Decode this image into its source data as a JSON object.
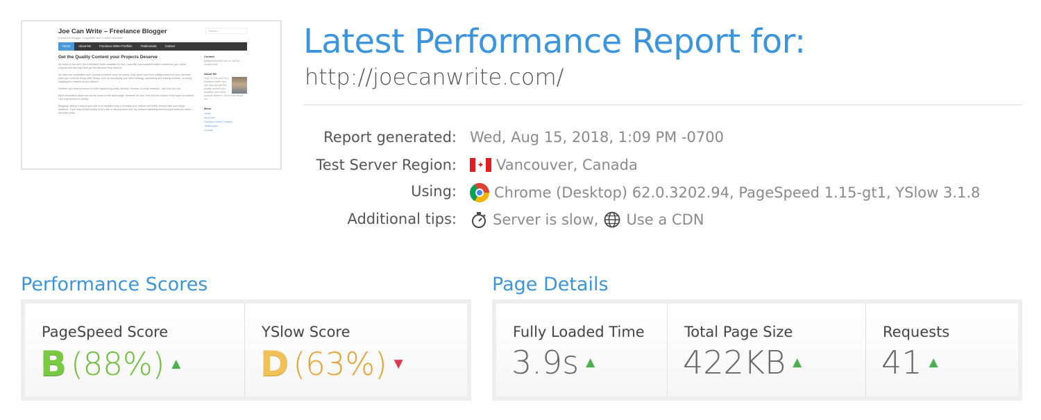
{
  "thumbnail": {
    "site_title": "Joe Can Write – Freelance Blogger",
    "tagline": "Freelance Blogger, Copywriter and Content Marketer",
    "search_placeholder": "Search ...",
    "nav": [
      "Home",
      "About Me",
      "Freelance Writer Portfolio",
      "Testimonials",
      "Contact"
    ],
    "heading": "Get the Quality Content your Projects Deserve",
    "paragraphs": [
      "My name is Joe and I am a freelance writer available for hire. I can offer you excellent written content for your online projects that can help them get the attention they deserve.",
      "My rates are competitive and I provide excellent value for money. Why spend your time writing content for your websites when you could be doing other things, such as developing your site's strategy, networking and making contacts, or simply enjoying the rewards of your labour?",
      "Whether you need someone to write regular blog posts, tutorials, reviews, or press releases, I can help you out.",
      "More information about me can be found on the about page. However for now, here is a list of some of the types of content I am experienced in writing:",
      "Blogging: adding a blog to your site is an excellent way to increase your visitors and better connect with your target audience. If you want to add a blog to your site or already have one, my content marketing service is just what you need. I can write posts"
    ],
    "sidebar": {
      "contact_heading": "Contact",
      "contact_text": "joe@joecanwrite.com or use the contact form",
      "about_heading": "About Me",
      "about_text": "Hey! I'm Joe and I'm a freelance writer who can help you get the quality content your websites and online projects deserve. Read more about me",
      "menu_heading": "Menu",
      "menu_items": [
        "Home",
        "About Me",
        "Freelance Writer Portfolio",
        "Testimonials",
        "Contact"
      ]
    }
  },
  "report": {
    "title": "Latest Performance Report for:",
    "url": "http://joecanwrite.com/",
    "generated_label": "Report generated:",
    "generated_value": "Wed, Aug 15, 2018, 1:09 PM -0700",
    "region_label": "Test Server Region:",
    "region_value": "Vancouver, Canada",
    "using_label": "Using:",
    "using_value": "Chrome (Desktop) 62.0.3202.94, PageSpeed 1.15-gt1, YSlow 3.1.8",
    "tips_label": "Additional tips:",
    "tip_1": "Server is slow,",
    "tip_2": "Use a CDN"
  },
  "performance": {
    "title": "Performance Scores",
    "pagespeed_label": "PageSpeed Score",
    "pagespeed_grade": "B",
    "pagespeed_pct": "(88%)",
    "pagespeed_trend": "up",
    "yslow_label": "YSlow Score",
    "yslow_grade": "D",
    "yslow_pct": "(63%)",
    "yslow_trend": "down"
  },
  "page_details": {
    "title": "Page Details",
    "load_label": "Fully Loaded Time",
    "load_value": "3.9s",
    "size_label": "Total Page Size",
    "size_value": "422KB",
    "requests_label": "Requests",
    "requests_value": "41"
  },
  "colors": {
    "accent": "#3b95dd",
    "grade_b": "#7ac943",
    "grade_d": "#f0c05a",
    "trend_up": "#4caf50",
    "trend_down": "#e03b55"
  }
}
